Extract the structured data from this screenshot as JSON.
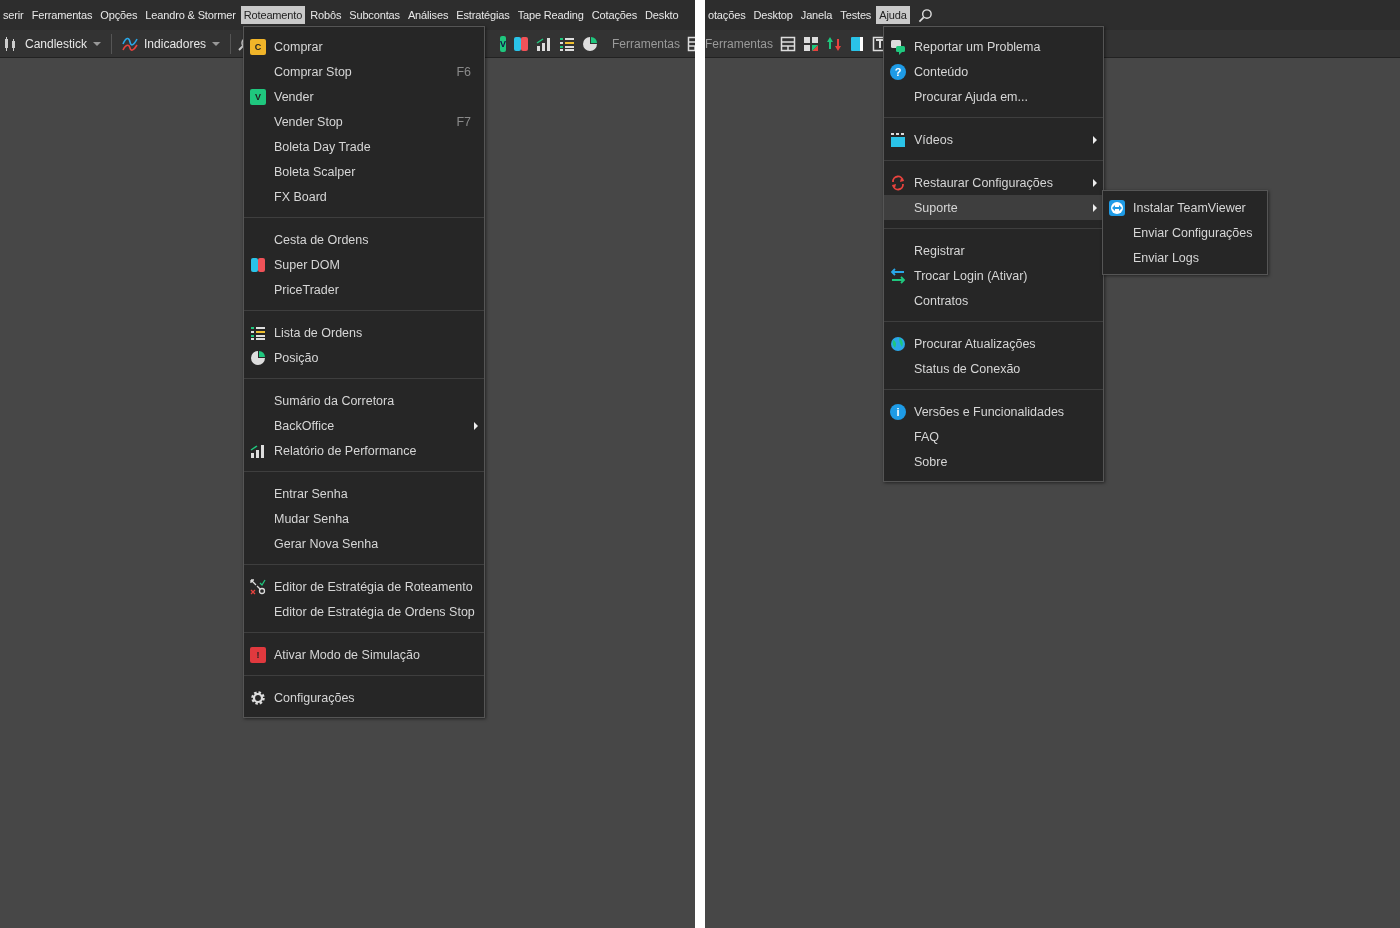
{
  "left_panel": {
    "menu_bar": [
      {
        "label": "serir",
        "selected": false
      },
      {
        "label": "Ferramentas",
        "selected": false
      },
      {
        "label": "Opções",
        "selected": false
      },
      {
        "label": "Leandro & Stormer",
        "selected": false
      },
      {
        "label": "Roteamento",
        "selected": true
      },
      {
        "label": "Robôs",
        "selected": false
      },
      {
        "label": "Subcontas",
        "selected": false
      },
      {
        "label": "Análises",
        "selected": false
      },
      {
        "label": "Estratégias",
        "selected": false
      },
      {
        "label": "Tape Reading",
        "selected": false
      },
      {
        "label": "Cotações",
        "selected": false
      },
      {
        "label": "Deskto",
        "selected": false
      }
    ],
    "toolbar": [
      {
        "kind": "dropdown",
        "label": "Candlestick"
      },
      {
        "kind": "divider"
      },
      {
        "kind": "dropdown",
        "label": "Indicadores"
      },
      {
        "kind": "divider"
      },
      {
        "kind": "icon"
      },
      {
        "kind": "gap"
      },
      {
        "kind": "badge",
        "label": "V",
        "color": "#1fc77e"
      },
      {
        "kind": "icon"
      },
      {
        "kind": "icon"
      },
      {
        "kind": "icon"
      },
      {
        "kind": "icon"
      },
      {
        "kind": "divider"
      },
      {
        "kind": "label",
        "label": "Ferramentas"
      },
      {
        "kind": "icon"
      }
    ],
    "menu": {
      "groups": [
        [
          {
            "label": "Comprar",
            "badge": "C",
            "color": "#f0b429",
            "submenu": false,
            "selected": false
          },
          {
            "label": "Comprar Stop",
            "shortcut": "F6",
            "submenu": false,
            "selected": false
          },
          {
            "label": "Vender",
            "badge": "V",
            "color": "#1fc77e",
            "submenu": false,
            "selected": false
          },
          {
            "label": "Vender Stop",
            "shortcut": "F7",
            "submenu": false,
            "selected": false
          },
          {
            "label": "Boleta Day Trade",
            "submenu": false,
            "selected": false
          },
          {
            "label": "Boleta Scalper",
            "submenu": false,
            "selected": false
          },
          {
            "label": "FX Board",
            "submenu": false,
            "selected": false
          }
        ],
        [
          {
            "label": "Cesta de Ordens",
            "submenu": false,
            "selected": false
          },
          {
            "label": "Super DOM",
            "submenu": false,
            "selected": false
          },
          {
            "label": "PriceTrader",
            "submenu": false,
            "selected": false
          }
        ],
        [
          {
            "label": "Lista de Ordens",
            "submenu": false,
            "selected": false
          },
          {
            "label": "Posição",
            "submenu": false,
            "selected": false
          }
        ],
        [
          {
            "label": "Sumário da Corretora",
            "submenu": false,
            "selected": false
          },
          {
            "label": "BackOffice",
            "submenu": true,
            "selected": false
          },
          {
            "label": "Relatório de Performance",
            "submenu": false,
            "selected": false
          }
        ],
        [
          {
            "label": "Entrar Senha",
            "submenu": false,
            "selected": false
          },
          {
            "label": "Mudar Senha",
            "submenu": false,
            "selected": false
          },
          {
            "label": "Gerar Nova Senha",
            "submenu": false,
            "selected": false
          }
        ],
        [
          {
            "label": "Editor de Estratégia de Roteamento",
            "submenu": false,
            "selected": false
          },
          {
            "label": "Editor de Estratégia de Ordens Stop",
            "submenu": false,
            "selected": false
          }
        ],
        [
          {
            "label": "Ativar Modo de Simulação",
            "badge": "!",
            "color": "#e0393e",
            "submenu": false,
            "selected": false
          }
        ],
        [
          {
            "label": "Configurações",
            "submenu": false,
            "selected": false
          }
        ]
      ]
    }
  },
  "right_panel": {
    "menu_bar": [
      {
        "label": "otações",
        "selected": false
      },
      {
        "label": "Desktop",
        "selected": false
      },
      {
        "label": "Janela",
        "selected": false
      },
      {
        "label": "Testes",
        "selected": false
      },
      {
        "label": "Ajuda",
        "selected": true
      }
    ],
    "toolbar": [
      {
        "kind": "label",
        "label": "Ferramentas"
      },
      {
        "kind": "icon"
      },
      {
        "kind": "icon"
      },
      {
        "kind": "icon"
      },
      {
        "kind": "icon"
      },
      {
        "kind": "icon"
      }
    ],
    "menu": {
      "groups": [
        [
          {
            "label": "Reportar um Problema",
            "submenu": false,
            "selected": false
          },
          {
            "label": "Conteúdo",
            "badge": "?",
            "color": "#1e9be6",
            "submenu": false,
            "selected": false
          },
          {
            "label": "Procurar Ajuda em...",
            "submenu": false,
            "selected": false
          }
        ],
        [
          {
            "label": "Vídeos",
            "submenu": true,
            "selected": false
          }
        ],
        [
          {
            "label": "Restaurar Configurações",
            "submenu": true,
            "selected": false
          },
          {
            "label": "Suporte",
            "submenu": true,
            "selected": true
          }
        ],
        [
          {
            "label": "Registrar",
            "submenu": false,
            "selected": false
          },
          {
            "label": "Trocar Login (Ativar)",
            "submenu": false,
            "selected": false
          },
          {
            "label": "Contratos",
            "submenu": false,
            "selected": false
          }
        ],
        [
          {
            "label": "Procurar Atualizações",
            "submenu": false,
            "selected": false
          },
          {
            "label": "Status de Conexão",
            "submenu": false,
            "selected": false
          }
        ],
        [
          {
            "label": "Versões e Funcionalidades",
            "badge": "i",
            "color": "#1e9be6",
            "submenu": false,
            "selected": false
          },
          {
            "label": "FAQ",
            "submenu": false,
            "selected": false
          },
          {
            "label": "Sobre",
            "submenu": false,
            "selected": false
          }
        ]
      ]
    },
    "submenu": [
      {
        "label": "Instalar TeamViewer",
        "selected": false
      },
      {
        "label": "Enviar Configurações",
        "selected": false
      },
      {
        "label": "Enviar Logs",
        "selected": false
      }
    ]
  }
}
